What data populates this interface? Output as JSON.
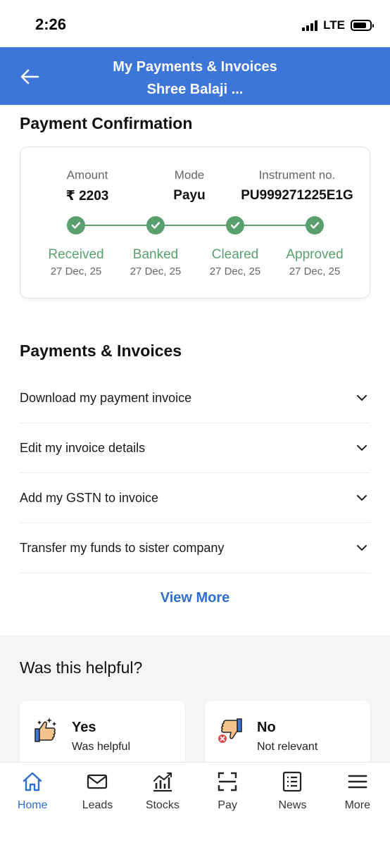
{
  "status_bar": {
    "time": "2:26",
    "network": "LTE"
  },
  "header": {
    "title": "My Payments & Invoices",
    "subtitle": "Shree Balaji ..."
  },
  "payment_confirmation": {
    "title": "Payment Confirmation",
    "amount_label": "Amount",
    "amount_value": "₹ 2203",
    "mode_label": "Mode",
    "mode_value": "Payu",
    "instrument_label": "Instrument no.",
    "instrument_value": "PU999271225E1G",
    "steps": [
      {
        "name": "Received",
        "date": "27 Dec, 25"
      },
      {
        "name": "Banked",
        "date": "27 Dec, 25"
      },
      {
        "name": "Cleared",
        "date": "27 Dec, 25"
      },
      {
        "name": "Approved",
        "date": "27 Dec, 25"
      }
    ]
  },
  "payments_invoices": {
    "title": "Payments & Invoices",
    "items": [
      "Download my payment invoice",
      "Edit my invoice details",
      "Add my GSTN to invoice",
      "Transfer my funds to sister company"
    ],
    "view_more": "View More"
  },
  "helpful": {
    "title": "Was this helpful?",
    "yes_title": "Yes",
    "yes_sub": "Was helpful",
    "no_title": "No",
    "no_sub": "Not relevant"
  },
  "nav": {
    "items": [
      "Home",
      "Leads",
      "Stocks",
      "Pay",
      "News",
      "More"
    ],
    "active": "Home"
  },
  "colors": {
    "primary": "#3d76d8",
    "link": "#2f6fcf",
    "success": "#5aa06f"
  }
}
